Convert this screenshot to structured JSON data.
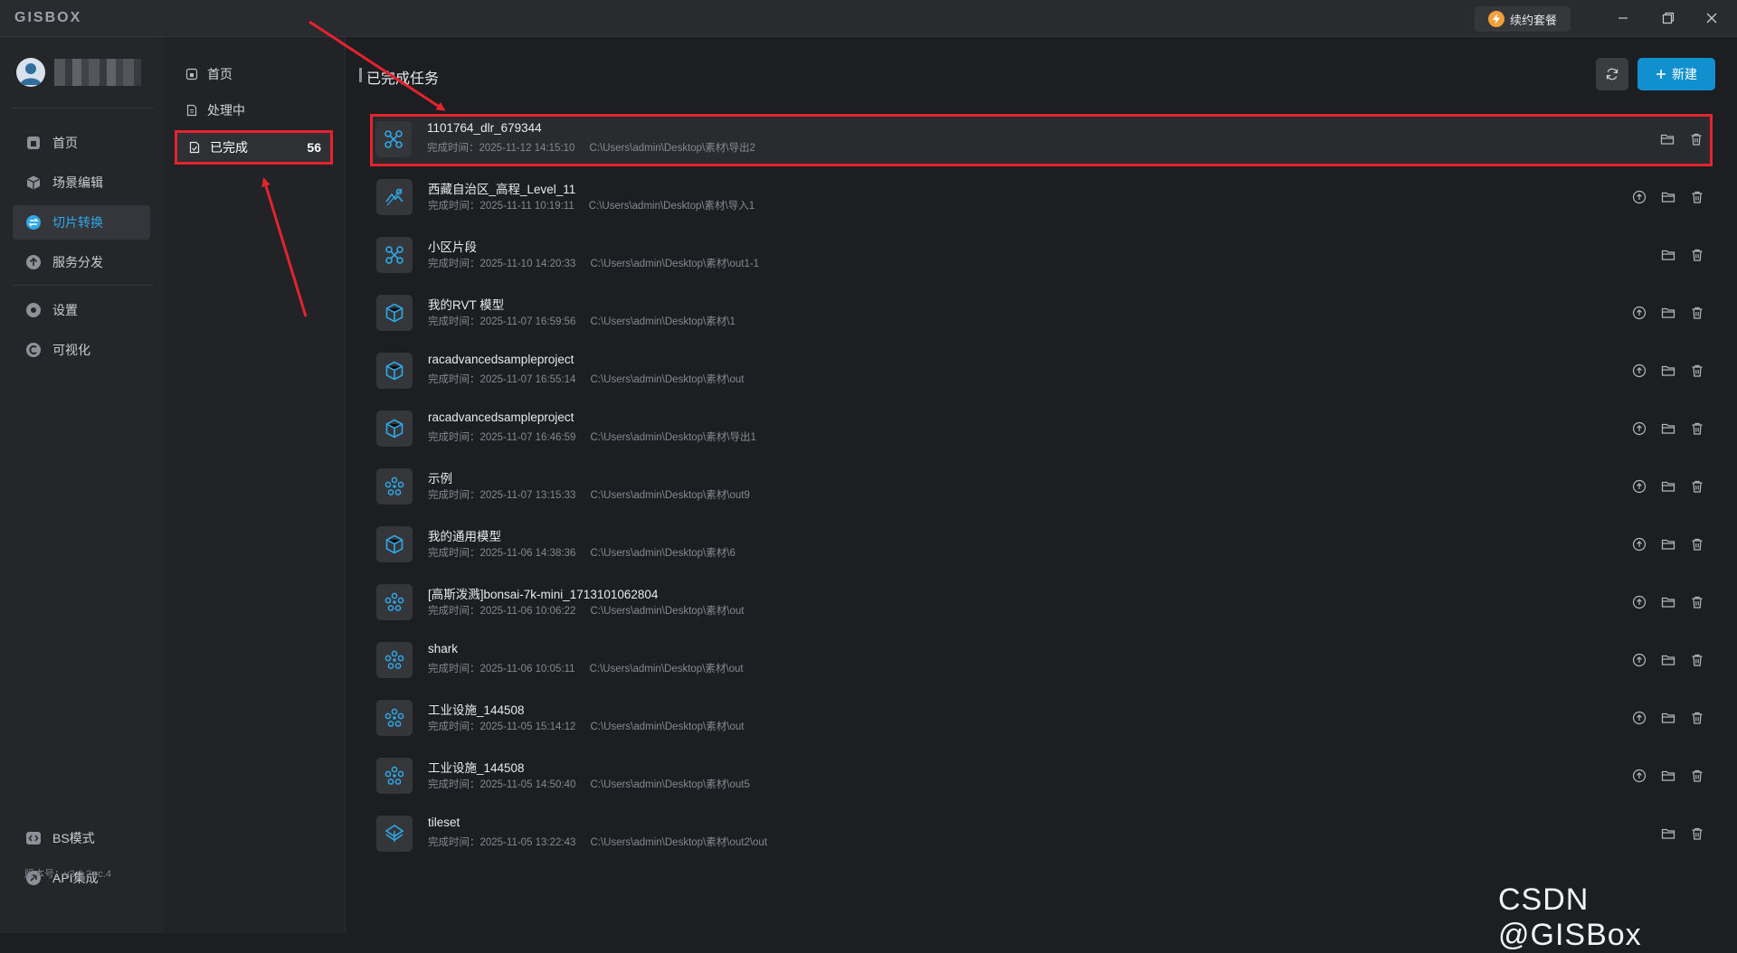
{
  "app": {
    "logo": "GISBOX",
    "renew_label": "续约套餐",
    "version": "版本号：v2.0.2-rc.4"
  },
  "sidebar": {
    "items": [
      {
        "label": "首页",
        "icon": "home-icon"
      },
      {
        "label": "场景编辑",
        "icon": "cube-icon"
      },
      {
        "label": "切片转换",
        "icon": "convert-icon",
        "active": true
      },
      {
        "label": "服务分发",
        "icon": "upload-icon"
      },
      {
        "label": "设置",
        "icon": "gear-icon"
      },
      {
        "label": "可视化",
        "icon": "visual-icon"
      }
    ],
    "bottom": [
      {
        "label": "BS模式",
        "icon": "code-icon"
      },
      {
        "label": "API集成",
        "icon": "api-icon"
      }
    ]
  },
  "subnav": {
    "items": [
      {
        "label": "首页"
      },
      {
        "label": "处理中"
      },
      {
        "label": "已完成",
        "count": "56",
        "active": true
      }
    ]
  },
  "main": {
    "title": "已完成任务",
    "new_label": "新建"
  },
  "tasks": [
    {
      "name": "1101764_dlr_679344",
      "time": "完成时间：2025-11-12 14:15:10",
      "path": "C:\\Users\\admin\\Desktop\\素材\\导出2",
      "icon": "network-icon",
      "upload": false
    },
    {
      "name": "西藏自治区_高程_Level_11",
      "time": "完成时间：2025-11-11 10:19:11",
      "path": "C:\\Users\\admin\\Desktop\\素材\\导入1",
      "icon": "terrain-icon",
      "upload": true
    },
    {
      "name": "小区片段",
      "time": "完成时间：2025-11-10 14:20:33",
      "path": "C:\\Users\\admin\\Desktop\\素材\\out1-1",
      "icon": "network-icon",
      "upload": false
    },
    {
      "name": "我的RVT 模型",
      "time": "完成时间：2025-11-07 16:59:56",
      "path": "C:\\Users\\admin\\Desktop\\素材\\1",
      "icon": "model-cube-icon",
      "upload": true
    },
    {
      "name": "racadvancedsampleproject",
      "time": "完成时间：2025-11-07 16:55:14",
      "path": "C:\\Users\\admin\\Desktop\\素材\\out",
      "icon": "model-cube-icon",
      "upload": true
    },
    {
      "name": "racadvancedsampleproject",
      "time": "完成时间：2025-11-07 16:46:59",
      "path": "C:\\Users\\admin\\Desktop\\素材\\导出1",
      "icon": "model-cube-icon",
      "upload": true
    },
    {
      "name": "示例",
      "time": "完成时间：2025-11-07 13:15:33",
      "path": "C:\\Users\\admin\\Desktop\\素材\\out9",
      "icon": "splat-icon",
      "upload": true
    },
    {
      "name": "我的通用模型",
      "time": "完成时间：2025-11-06 14:38:36",
      "path": "C:\\Users\\admin\\Desktop\\素材\\6",
      "icon": "model-cube-icon",
      "upload": true
    },
    {
      "name": "[高斯泼溅]bonsai-7k-mini_1713101062804",
      "time": "完成时间：2025-11-06 10:06:22",
      "path": "C:\\Users\\admin\\Desktop\\素材\\out",
      "icon": "splat-icon",
      "upload": true
    },
    {
      "name": "shark",
      "time": "完成时间：2025-11-06 10:05:11",
      "path": "C:\\Users\\admin\\Desktop\\素材\\out",
      "icon": "splat-icon",
      "upload": true
    },
    {
      "name": "工业设施_144508",
      "time": "完成时间：2025-11-05 15:14:12",
      "path": "C:\\Users\\admin\\Desktop\\素材\\out",
      "icon": "splat-icon",
      "upload": true
    },
    {
      "name": "工业设施_144508",
      "time": "完成时间：2025-11-05 14:50:40",
      "path": "C:\\Users\\admin\\Desktop\\素材\\out5",
      "icon": "splat-icon",
      "upload": true
    },
    {
      "name": "tileset",
      "time": "完成时间：2025-11-05 13:22:43",
      "path": "C:\\Users\\admin\\Desktop\\素材\\out2\\out",
      "icon": "tileset-icon",
      "upload": false
    }
  ],
  "watermark": "CSDN @GISBox",
  "colors": {
    "accent": "#1190cf",
    "highlight": "#e3232e",
    "icon": "#2fa8e8"
  }
}
